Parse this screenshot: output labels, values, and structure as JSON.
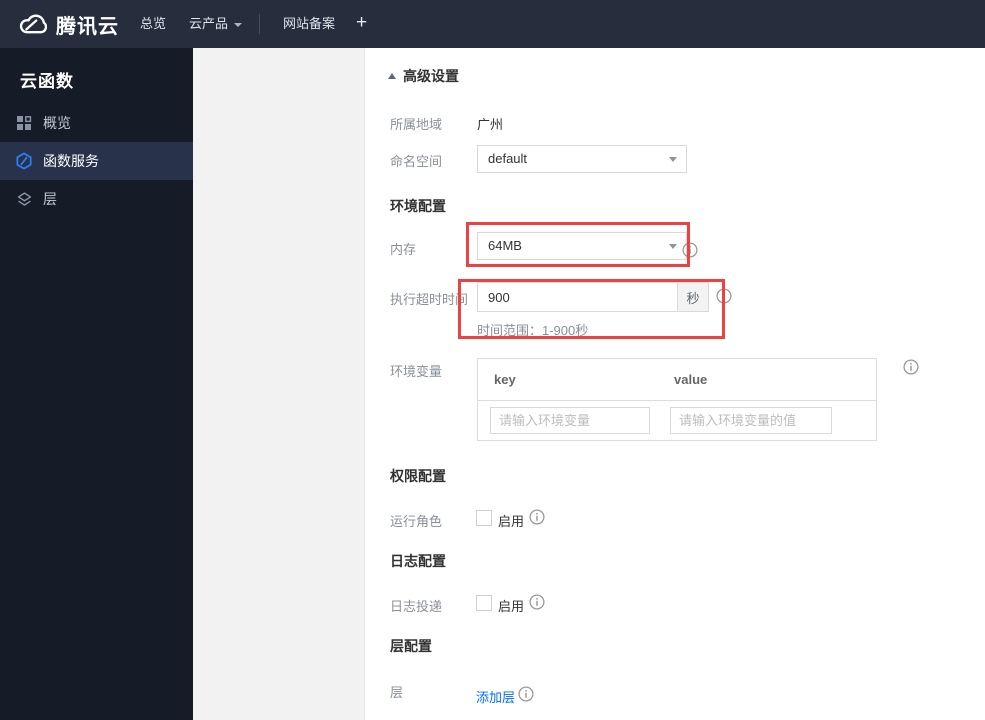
{
  "topbar": {
    "brand": "腾讯云",
    "nav": [
      {
        "label": "总览"
      },
      {
        "label": "云产品"
      },
      {
        "label": "网站备案"
      },
      {
        "label": "+"
      }
    ]
  },
  "sidebar": {
    "title": "云函数",
    "items": [
      {
        "label": "概览",
        "icon": "grid-icon",
        "active": false
      },
      {
        "label": "函数服务",
        "icon": "hexagon-function-icon",
        "active": true
      },
      {
        "label": "层",
        "icon": "layers-icon",
        "active": false
      }
    ]
  },
  "content": {
    "advanced_label": "高级设置",
    "region_label": "所属地域",
    "region_value": "广州",
    "namespace_label": "命名空间",
    "namespace_value": "default",
    "env_section_title": "环境配置",
    "memory_label": "内存",
    "memory_value": "64MB",
    "timeout_label": "执行超时时间",
    "timeout_value": "900",
    "timeout_unit": "秒",
    "timeout_hint": "时间范围：1-900秒",
    "envvar_label": "环境变量",
    "envvar_key_header": "key",
    "envvar_value_header": "value",
    "envvar_key_placeholder": "请输入环境变量",
    "envvar_value_placeholder": "请输入环境变量的值",
    "perm_section_title": "权限配置",
    "role_label": "运行角色",
    "role_checkbox_label": "启用",
    "log_section_title": "日志配置",
    "logship_label": "日志投递",
    "logship_checkbox_label": "启用",
    "layer_section_title": "层配置",
    "layer_label": "层",
    "add_layer_label": "添加层"
  },
  "icons": {
    "brand": "cloud-icon",
    "nav_caret": "caret-down-icon",
    "dropdown_caret": "caret-down-icon",
    "advanced_toggle": "triangle-up-icon",
    "info": "info-circle-icon"
  },
  "colors": {
    "accent_blue": "#006eff",
    "annotation_red": "#ee4141",
    "topbar_bg": "#262e3e",
    "sidebar_bg": "#151b27",
    "sidebar_active_bg": "#28334b",
    "panel_gray": "#f2f2f2"
  }
}
